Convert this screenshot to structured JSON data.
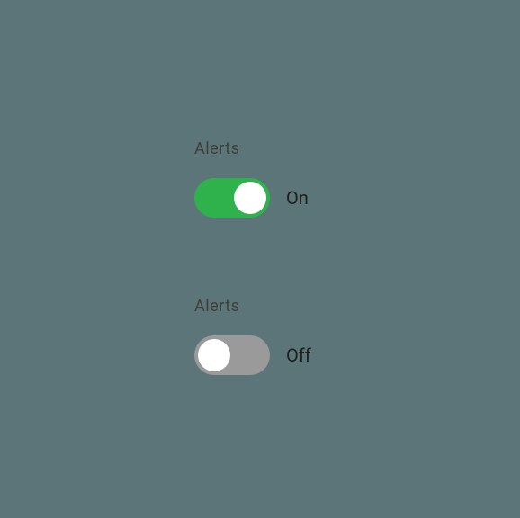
{
  "toggles": [
    {
      "label": "Alerts",
      "state_text": "On",
      "on": true
    },
    {
      "label": "Alerts",
      "state_text": "Off",
      "on": false
    }
  ],
  "colors": {
    "background": "#5b7579",
    "toggle_on": "#2fb24c",
    "toggle_off": "#9a9a9a",
    "knob": "#ffffff"
  }
}
